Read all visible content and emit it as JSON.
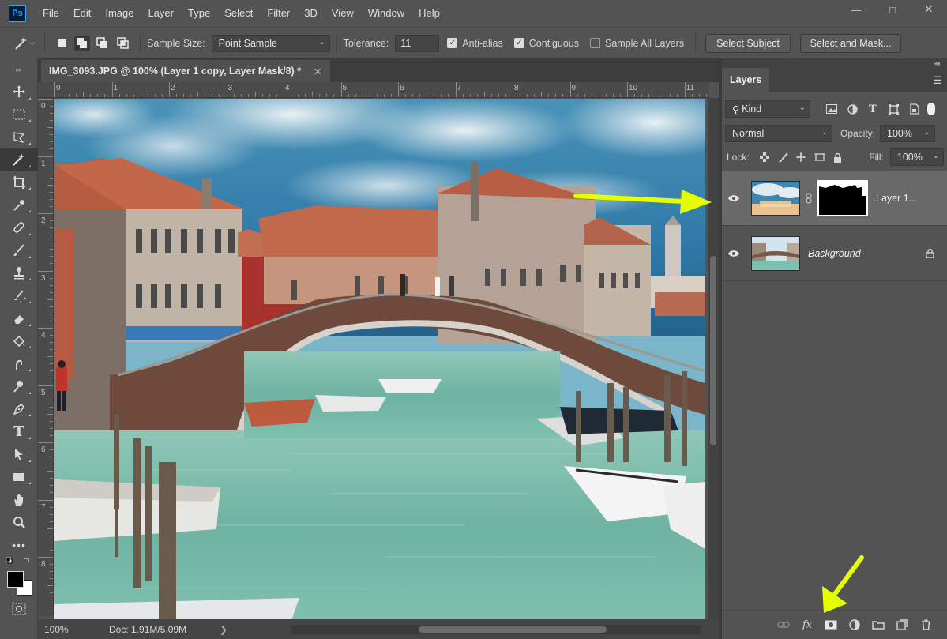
{
  "app": {
    "logo": "Ps"
  },
  "menu": [
    "File",
    "Edit",
    "Image",
    "Layer",
    "Type",
    "Select",
    "Filter",
    "3D",
    "View",
    "Window",
    "Help"
  ],
  "window_controls": {
    "minimize": "—",
    "maximize": "□",
    "close": "✕"
  },
  "options": {
    "tool_icon": "magic-wand-icon",
    "sample_size_label": "Sample Size:",
    "sample_size_value": "Point Sample",
    "tolerance_label": "Tolerance:",
    "tolerance_value": "11",
    "anti_alias_label": "Anti-alias",
    "anti_alias_checked": true,
    "contiguous_label": "Contiguous",
    "contiguous_checked": true,
    "sample_all_layers_label": "Sample All Layers",
    "sample_all_layers_checked": false,
    "select_subject_label": "Select Subject",
    "select_and_mask_label": "Select and Mask..."
  },
  "document": {
    "tab_title": "IMG_3093.JPG @ 100% (Layer 1 copy, Layer Mask/8) *",
    "tab_close": "✕",
    "ruler_top": [
      "0",
      "1",
      "2",
      "3",
      "4",
      "5",
      "6",
      "7",
      "8",
      "9",
      "10",
      "11"
    ],
    "ruler_left": [
      "0",
      "1",
      "2",
      "3",
      "4",
      "5",
      "6",
      "7",
      "8"
    ]
  },
  "status": {
    "zoom": "100%",
    "doc_size": "Doc: 1.91M/5.09M",
    "arrow": "❯"
  },
  "tools": [
    {
      "name": "move-tool",
      "glyph": "✛"
    },
    {
      "name": "marquee-tool",
      "glyph": "⬚"
    },
    {
      "name": "lasso-tool",
      "glyph": "➳"
    },
    {
      "name": "magic-wand-tool",
      "glyph": "✨",
      "active": true
    },
    {
      "name": "crop-tool",
      "glyph": "⌖"
    },
    {
      "name": "eyedropper-tool",
      "glyph": "✐"
    },
    {
      "name": "healing-brush-tool",
      "glyph": "⚕"
    },
    {
      "name": "brush-tool",
      "glyph": "✎"
    },
    {
      "name": "clone-stamp-tool",
      "glyph": "❂"
    },
    {
      "name": "history-brush-tool",
      "glyph": "✑"
    },
    {
      "name": "eraser-tool",
      "glyph": "▭"
    },
    {
      "name": "paint-bucket-tool",
      "glyph": "❖"
    },
    {
      "name": "blur-tool",
      "glyph": "▲"
    },
    {
      "name": "dodge-tool",
      "glyph": "☉"
    },
    {
      "name": "pen-tool",
      "glyph": "✒"
    },
    {
      "name": "type-tool",
      "glyph": "T"
    },
    {
      "name": "path-selection-tool",
      "glyph": "➤"
    },
    {
      "name": "rectangle-tool",
      "glyph": "▭"
    },
    {
      "name": "hand-tool",
      "glyph": "✋"
    },
    {
      "name": "zoom-tool",
      "glyph": "⌕"
    },
    {
      "name": "more-tools",
      "glyph": "…"
    }
  ],
  "colors": {
    "foreground": "#000000",
    "background": "#ffffff",
    "accent_arrow": "#e6ff00"
  },
  "layers_panel": {
    "tab_label": "Layers",
    "kind_label": "Kind",
    "blend_mode": "Normal",
    "opacity_label": "Opacity:",
    "opacity_value": "100%",
    "lock_label": "Lock:",
    "fill_label": "Fill:",
    "fill_value": "100%",
    "layers": [
      {
        "name": "Layer 1...",
        "visible": true,
        "selected": true,
        "has_mask": true
      },
      {
        "name": "Background",
        "visible": true,
        "selected": false,
        "locked": true
      }
    ],
    "bottom_icons": [
      "link-layers-icon",
      "fx-icon",
      "add-mask-icon",
      "adjustment-icon",
      "group-icon",
      "new-layer-icon",
      "delete-icon"
    ]
  }
}
